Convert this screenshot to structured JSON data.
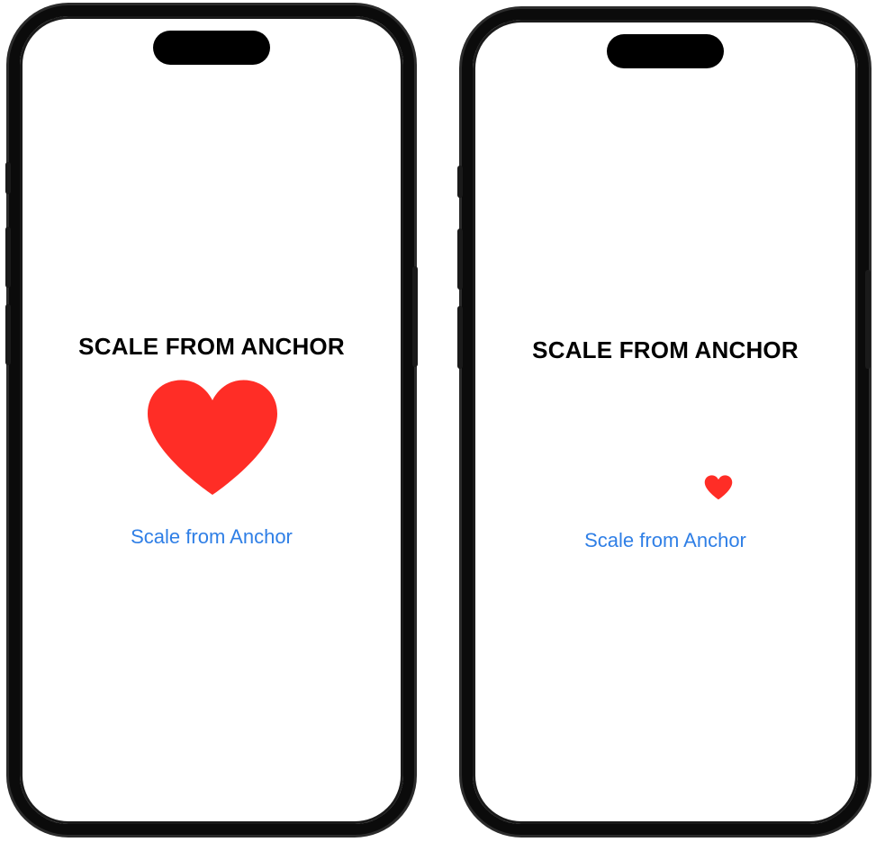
{
  "screens": [
    {
      "title": "SCALE FROM ANCHOR",
      "heart_scale": 1.0,
      "button_label": "Scale from Anchor"
    },
    {
      "title": "SCALE FROM ANCHOR",
      "heart_scale": 0.2,
      "button_label": "Scale from Anchor"
    }
  ],
  "colors": {
    "heart": "#ff2d26",
    "accent": "#2f7fe6",
    "frame": "#0b0b0b"
  },
  "icons": {
    "heart": "heart-icon"
  }
}
